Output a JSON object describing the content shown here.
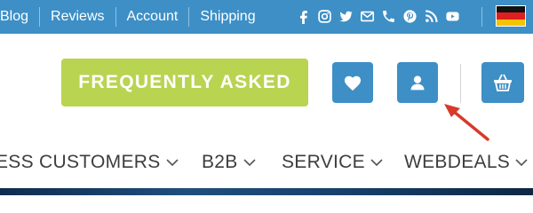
{
  "topbar": {
    "links": [
      {
        "label": "Blog"
      },
      {
        "label": "Reviews"
      },
      {
        "label": "Account"
      },
      {
        "label": "Shipping"
      }
    ],
    "social_icons": [
      "facebook-icon",
      "instagram-icon",
      "twitter-icon",
      "mail-icon",
      "phone-icon",
      "pinterest-icon",
      "rss-icon",
      "youtube-icon"
    ],
    "language_flag": "german-flag-icon"
  },
  "header": {
    "faq_label": "FREQUENTLY ASKED",
    "icons": [
      "heart-icon",
      "user-icon",
      "basket-icon"
    ]
  },
  "nav": {
    "items": [
      {
        "label": "ESS CUSTOMERS"
      },
      {
        "label": "B2B"
      },
      {
        "label": "SERVICE"
      },
      {
        "label": "WEBDEALS"
      }
    ]
  },
  "colors": {
    "brand_blue": "#3d8fc6",
    "faq_green": "#b9d451",
    "arrow_red": "#d8392a",
    "nav_text": "#3d3d3d"
  }
}
